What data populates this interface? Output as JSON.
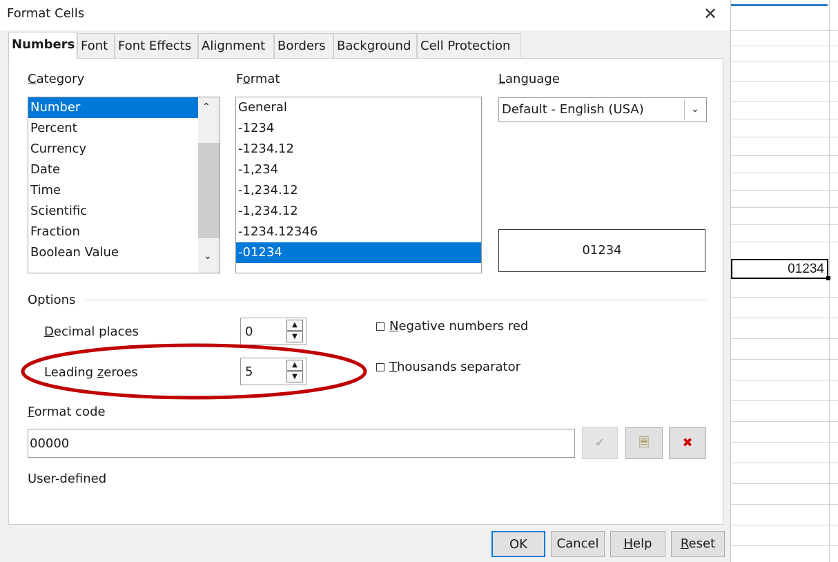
{
  "dialog": {
    "title": "Format Cells"
  },
  "tabs": [
    {
      "label": "Numbers"
    },
    {
      "label": "Font"
    },
    {
      "label": "Font Effects"
    },
    {
      "label": "Alignment"
    },
    {
      "label": "Borders"
    },
    {
      "label": "Background"
    },
    {
      "label": "Cell Protection"
    }
  ],
  "category": {
    "label": "Category",
    "items": [
      "Number",
      "Percent",
      "Currency",
      "Date",
      "Time",
      "Scientific",
      "Fraction",
      "Boolean Value"
    ],
    "selected": "Number"
  },
  "format": {
    "label": "Format",
    "items": [
      "General",
      "-1234",
      "-1234.12",
      "-1,234",
      "-1,234.12",
      "-1,234.12",
      "-1234.12346",
      "-01234"
    ],
    "selected": "-01234"
  },
  "language": {
    "label": "Language",
    "value": "Default - English (USA)"
  },
  "preview": {
    "value": "01234"
  },
  "options": {
    "label": "Options",
    "decimal_places": {
      "label": "Decimal places",
      "value": "0"
    },
    "leading_zeroes": {
      "label": "Leading zeroes",
      "value": "5"
    },
    "negative_red": {
      "label": "Negative numbers red",
      "checked": false
    },
    "thousands_sep": {
      "label": "Thousands separator",
      "checked": false
    }
  },
  "format_code": {
    "label": "Format code",
    "value": "00000",
    "status": "User-defined"
  },
  "buttons": {
    "ok": "OK",
    "cancel": "Cancel",
    "help": "Help",
    "reset": "Reset"
  },
  "sheet": {
    "cell_value": "01234"
  },
  "colors": {
    "selection": "#0078d7",
    "highlight_ring": "#c00000",
    "accent": "#2e78c7"
  },
  "icons": [
    "close-icon",
    "check-icon",
    "comment-icon",
    "delete-icon",
    "chevron-up-icon",
    "chevron-down-icon"
  ]
}
